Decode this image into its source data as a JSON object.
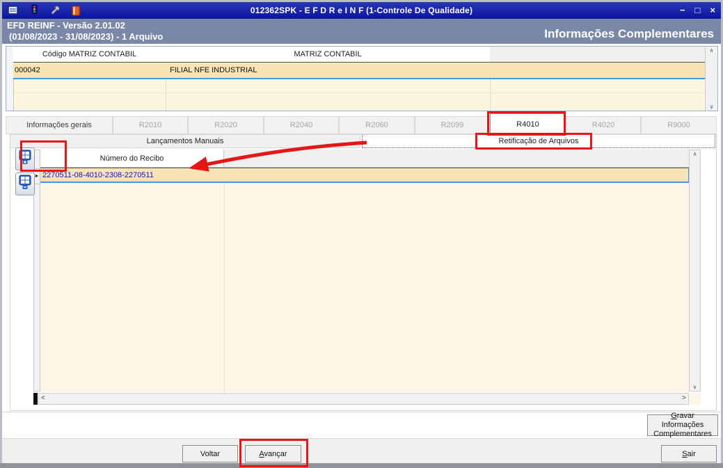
{
  "titlebar": {
    "title": "012362SPK - E F D   R e I N F (1-Controle De Qualidade)",
    "controls": {
      "minimize": "−",
      "maximize": "□",
      "close": "×"
    }
  },
  "header": {
    "line1": "EFD REINF - Versão 2.01.02",
    "line2": "(01/08/2023 - 31/08/2023) - 1 Arquivo",
    "right_title": "Informações Complementares"
  },
  "matrix_table": {
    "columns": [
      "Código MATRIZ CONTABIL",
      "MATRIZ CONTABIL"
    ],
    "rows": [
      {
        "codigo": "000042",
        "nome": "FILIAL NFE INDUSTRIAL"
      }
    ]
  },
  "tabs": {
    "selected": "R4010",
    "items": [
      {
        "label": "Informações gerais"
      },
      {
        "label": "R2010"
      },
      {
        "label": "R2020"
      },
      {
        "label": "R2040"
      },
      {
        "label": "R2060"
      },
      {
        "label": "R2099"
      },
      {
        "label": "R4010"
      },
      {
        "label": "R4020"
      },
      {
        "label": "R9000"
      }
    ]
  },
  "subtabs": {
    "left": "Lançamentos Manuais",
    "right": "Retificação de Arquivos"
  },
  "grid": {
    "column": "Número do Recibo",
    "rows": [
      {
        "recibo": "2270511-08-4010-2308-2270511"
      }
    ]
  },
  "buttons": {
    "voltar": "Voltar",
    "avancar_head": "A",
    "avancar_tail": "vançar",
    "sair_head": "S",
    "sair_tail": "air",
    "gravar_line1_head": "G",
    "gravar_line1_tail": "ravar Informações",
    "gravar_line2": "Complementares"
  },
  "icons": {
    "scroll_up": "∧",
    "scroll_down": "∨",
    "scroll_left": "<",
    "scroll_right": ">",
    "row_pointer": "►"
  },
  "annotations": {
    "color": "#E41616",
    "boxes": [
      "tab R4010",
      "subtab Retificação de Arquivos",
      "insert-row tool button",
      "Avançar button"
    ],
    "arrow_points_to": "grid row 2270511-08-4010-2308-2270511"
  }
}
